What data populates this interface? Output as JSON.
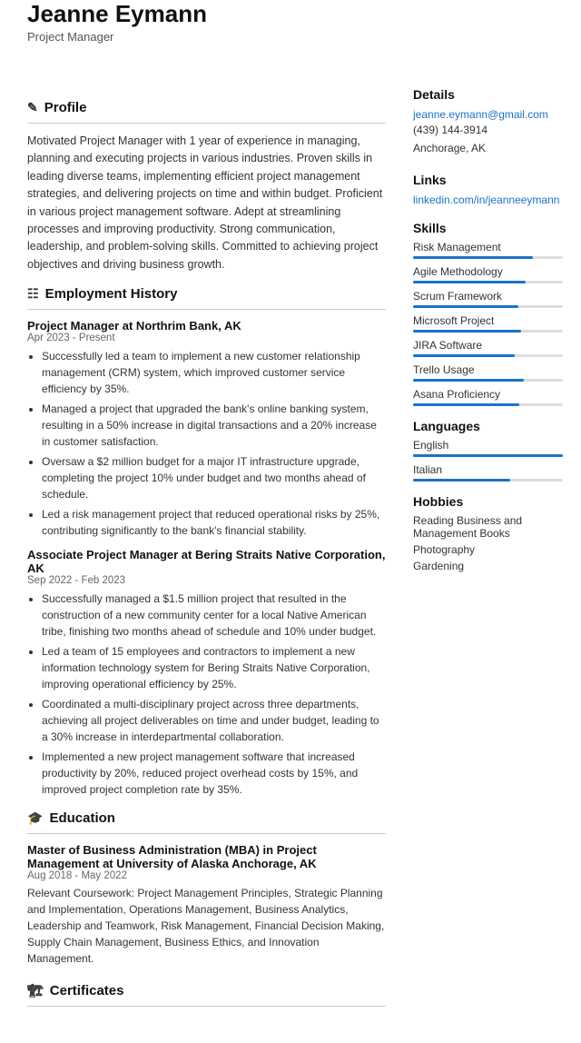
{
  "header": {
    "name": "Jeanne Eymann",
    "subtitle": "Project Manager"
  },
  "profile": {
    "section_label": "Profile",
    "icon": "👤",
    "text": "Motivated Project Manager with 1 year of experience in managing, planning and executing projects in various industries. Proven skills in leading diverse teams, implementing efficient project management strategies, and delivering projects on time and within budget. Proficient in various project management software. Adept at streamlining processes and improving productivity. Strong communication, leadership, and problem-solving skills. Committed to achieving project objectives and driving business growth."
  },
  "employment": {
    "section_label": "Employment History",
    "icon": "🏢",
    "jobs": [
      {
        "title": "Project Manager at Northrim Bank, AK",
        "date": "Apr 2023 - Present",
        "bullets": [
          "Successfully led a team to implement a new customer relationship management (CRM) system, which improved customer service efficiency by 35%.",
          "Managed a project that upgraded the bank's online banking system, resulting in a 50% increase in digital transactions and a 20% increase in customer satisfaction.",
          "Oversaw a $2 million budget for a major IT infrastructure upgrade, completing the project 10% under budget and two months ahead of schedule.",
          "Led a risk management project that reduced operational risks by 25%, contributing significantly to the bank's financial stability."
        ]
      },
      {
        "title": "Associate Project Manager at Bering Straits Native Corporation, AK",
        "date": "Sep 2022 - Feb 2023",
        "bullets": [
          "Successfully managed a $1.5 million project that resulted in the construction of a new community center for a local Native American tribe, finishing two months ahead of schedule and 10% under budget.",
          "Led a team of 15 employees and contractors to implement a new information technology system for Bering Straits Native Corporation, improving operational efficiency by 25%.",
          "Coordinated a multi-disciplinary project across three departments, achieving all project deliverables on time and under budget, leading to a 30% increase in interdepartmental collaboration.",
          "Implemented a new project management software that increased productivity by 20%, reduced project overhead costs by 15%, and improved project completion rate by 35%."
        ]
      }
    ]
  },
  "education": {
    "section_label": "Education",
    "icon": "🎓",
    "entries": [
      {
        "title": "Master of Business Administration (MBA) in Project Management at University of Alaska Anchorage, AK",
        "date": "Aug 2018 - May 2022",
        "text": "Relevant Coursework: Project Management Principles, Strategic Planning and Implementation, Operations Management, Business Analytics, Leadership and Teamwork, Risk Management, Financial Decision Making, Supply Chain Management, Business Ethics, and Innovation Management."
      }
    ]
  },
  "certificates": {
    "section_label": "Certificates",
    "icon": "🏅"
  },
  "details": {
    "section_label": "Details",
    "email": "jeanne.eymann@gmail.com",
    "phone": "(439) 144-3914",
    "location": "Anchorage, AK"
  },
  "links": {
    "section_label": "Links",
    "linkedin": "linkedin.com/in/jeanneeymann"
  },
  "skills": {
    "section_label": "Skills",
    "items": [
      {
        "label": "Risk Management",
        "percent": 80
      },
      {
        "label": "Agile Methodology",
        "percent": 75
      },
      {
        "label": "Scrum Framework",
        "percent": 70
      },
      {
        "label": "Microsoft Project",
        "percent": 72
      },
      {
        "label": "JIRA Software",
        "percent": 68
      },
      {
        "label": "Trello Usage",
        "percent": 74
      },
      {
        "label": "Asana Proficiency",
        "percent": 71
      }
    ]
  },
  "languages": {
    "section_label": "Languages",
    "items": [
      {
        "label": "English",
        "percent": 100
      },
      {
        "label": "Italian",
        "percent": 65
      }
    ]
  },
  "hobbies": {
    "section_label": "Hobbies",
    "items": [
      "Reading Business and Management Books",
      "Photography",
      "Gardening"
    ]
  }
}
